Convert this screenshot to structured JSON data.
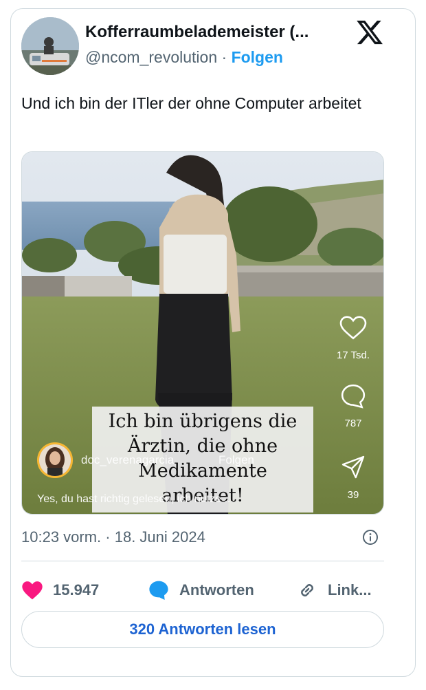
{
  "tweet": {
    "display_name": "Kofferraumbelademeister (...",
    "handle": "@ncom_revolution",
    "separator": " · ",
    "follow_label": "Folgen",
    "text": "Und ich bin der ITler der ohne Computer arbeitet",
    "timestamp": "10:23 vorm. · 18. Juni 2024"
  },
  "video": {
    "caption_lines": [
      "Ich bin übrigens die",
      "Ärztin, die ohne",
      "Medikamente arbeitet!"
    ],
    "likes": "17 Tsd.",
    "comments": "787",
    "shares": "39",
    "creator_name": "doc_verenagarcia",
    "creator_follow": "Folgen",
    "description": "Yes, du hast richtig gelesen, ich nutze ..."
  },
  "actions": {
    "like_count": "15.947",
    "reply_label": "Antworten",
    "link_label": "Link...",
    "read_replies_label": "320 Antworten lesen"
  },
  "colors": {
    "accent": "#1d9bf0",
    "heart": "#f91880",
    "reply_icon": "#1d9bf0",
    "read_button_text": "#1d63d2"
  }
}
